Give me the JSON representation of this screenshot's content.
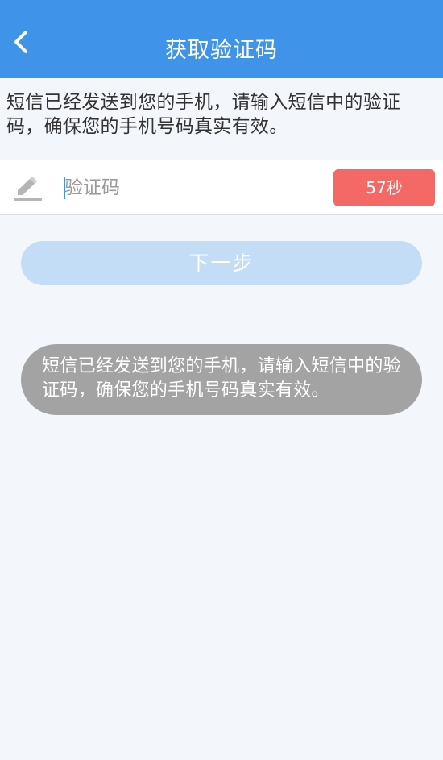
{
  "header": {
    "title": "获取验证码",
    "back_icon": "chevron-left-icon",
    "background_color": "#3f94ea"
  },
  "info": {
    "text": "短信已经发送到您的手机，请输入短信中的验证码，确保您的手机号码真实有效。"
  },
  "code_field": {
    "edit_icon": "pencil-icon",
    "placeholder": "验证码",
    "value": ""
  },
  "countdown": {
    "label": "57秒",
    "color": "#f46865"
  },
  "next_button": {
    "label": "下一步",
    "color": "#c4ddf7"
  },
  "toast": {
    "text": "短信已经发送到您的手机，请输入短信中的验证码，确保您的手机号码真实有效。"
  }
}
